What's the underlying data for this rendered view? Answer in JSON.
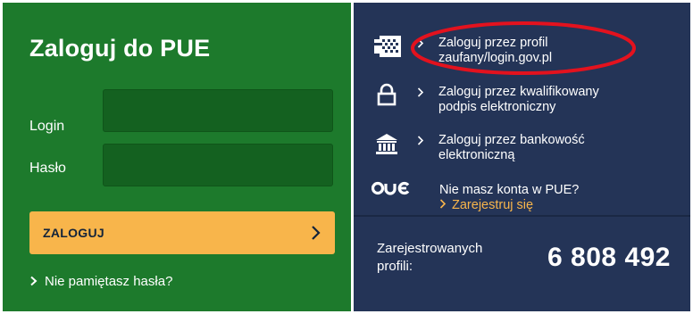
{
  "login": {
    "title": "Zaloguj do PUE",
    "login_label": "Login",
    "login_value": "",
    "password_label": "Hasło",
    "password_value": "",
    "submit_label": "ZALOGUJ",
    "forgot_label": "Nie pamiętasz hasła?"
  },
  "options": {
    "items": [
      {
        "icon": "trusted-profile-icon",
        "label_line1": "Zaloguj przez profil",
        "label_line2": "zaufany/login.gov.pl"
      },
      {
        "icon": "padlock-icon",
        "label_line1": "Zaloguj przez kwalifikowany",
        "label_line2": "podpis elektroniczny"
      },
      {
        "icon": "bank-icon",
        "label_line1": "Zaloguj przez bankowość",
        "label_line2": "elektroniczną"
      }
    ],
    "no_account_text": "Nie masz konta w PUE?",
    "register_label": "Zarejestruj się",
    "pue_logo_icon": "pue-logo-icon"
  },
  "stats": {
    "label_line1": "Zarejestrowanych",
    "label_line2": "profili:",
    "count": "6 808 492"
  },
  "colors": {
    "green_panel": "#1d7a2c",
    "navy_panel": "#243457",
    "accent_orange": "#f8b54b",
    "highlight_red": "#e3121e"
  }
}
